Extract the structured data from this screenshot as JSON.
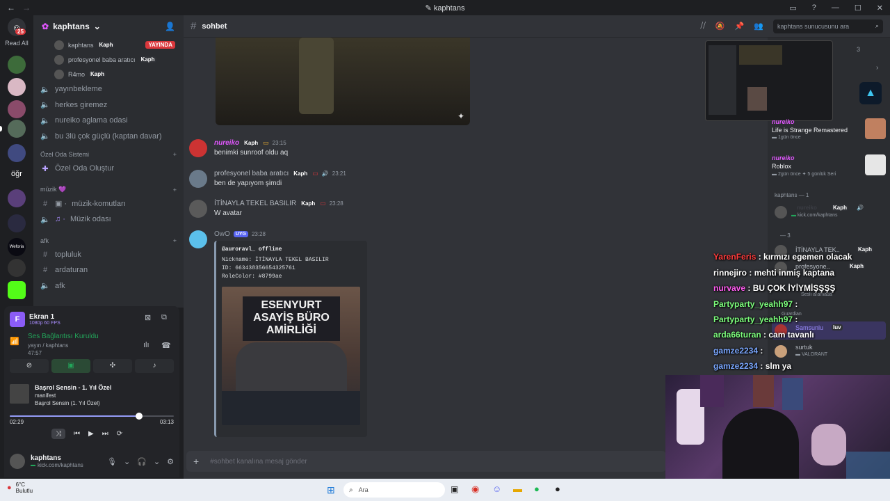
{
  "window": {
    "title": "kaphtans"
  },
  "rail": {
    "read_all": "Read All",
    "badge": "25",
    "ogr": "öğr",
    "weforia": "Weforia"
  },
  "server": {
    "name": "kaphtans",
    "voice_users": [
      {
        "name": "kaphtans",
        "tag": "Kaph",
        "live": "YAYINDA"
      },
      {
        "name": "profesyonel baba aratıcı",
        "tag": "Kaph"
      },
      {
        "name": "R4mo",
        "tag": "Kaph"
      }
    ],
    "channels_top": [
      "yayınbekleme",
      "herkes giremez",
      "nureiko aglama odasi",
      "bu 3lü çok güçlü (kaptan davar)"
    ],
    "cat_private": "Özel Oda Sistemi",
    "create_room": "Özel Oda Oluştur",
    "cat_music": "müzik 💜",
    "music_channels": [
      "müzik-komutları",
      "Müzik odası"
    ],
    "cat_afk": "afk",
    "afk_channels": [
      "topluluk",
      "ardaturan",
      "afk"
    ]
  },
  "panel": {
    "screen_title": "Ekran 1",
    "screen_sub": "1080p 60 FPS",
    "voice_status": "Ses Bağlantısı Kuruldu",
    "voice_channel": "yayın / kaphtans",
    "voice_time": "47:57",
    "song_title": "Başrol Sensin - 1. Yıl Özel",
    "song_artist": "manifest",
    "song_album": "Başrol Sensin (1. Yıl Özel)",
    "elapsed": "02:29",
    "total": "03:13",
    "progress": 0.79
  },
  "user": {
    "name": "kaphtans",
    "status": "kick.com/kaphtans"
  },
  "channel": {
    "name": "sohbet",
    "search_placeholder": "kaphtans sunucusunu ara",
    "input_placeholder": "#sohbet kanalına mesaj gönder"
  },
  "messages": [
    {
      "author": "nureiko",
      "tag": "Kaph",
      "time": "23:15",
      "text": "benimki sunroof oldu aq",
      "color": "#e056fd"
    },
    {
      "author": "profesyonel baba aratıcı",
      "tag": "Kaph",
      "time": "23:21",
      "text": "ben de yapıyom şimdi",
      "color": "#b5bac1"
    },
    {
      "author": "İTİNAYLA TEKEL BASILIR",
      "tag": "Kaph",
      "time": "23:28",
      "text": "W avatar",
      "color": "#b5bac1"
    }
  ],
  "bot": {
    "author": "OwO",
    "badge": "UYG",
    "time": "23:28",
    "embed_title": "@auroravl_ offline",
    "embed_lines": [
      "Nickname: İTİNAYLA TEKEL BASILIR",
      "ID: 663438356654325761",
      "RoleColor: #8799ae"
    ],
    "image_text_1": "ESENYURT",
    "image_text_2": "ASAYİŞ BÜRO",
    "image_text_3": "AMİRLİĞİ"
  },
  "activity": {
    "items": [
      {
        "user": "nureiko",
        "game": "Life is Strange Remastered",
        "meta": "1gün önce"
      },
      {
        "user": "nureiko",
        "game": "Roblox",
        "meta": "2gün önce",
        "streak": "5 günlük Seri"
      }
    ],
    "members_header": "kaphtans — 1",
    "member_status": "kick.com/kaphtans",
    "group_header": "— 3",
    "members": [
      {
        "name": "İTİNAYLA TEK..",
        "tag": "Kaph"
      },
      {
        "name": "profesyone..",
        "tag": "Kaph"
      },
      {
        "name": "Samsunlu",
        "tag": "luv"
      },
      {
        "name": "surtuk",
        "tag": "",
        "status": "VALORANT"
      }
    ],
    "voice_status": "Sesli aramada",
    "guardian": "Guardian",
    "screen_count": "3"
  },
  "overlay_chat": [
    {
      "user": "YarenFeris",
      "text": "kırmızı egemen olacak",
      "color": "#ff3b3b"
    },
    {
      "user": "rinnejiro",
      "text": "mehti inmiş kaptana",
      "color": "#ffffff"
    },
    {
      "user": "nurvave",
      "text": "BU ÇOK İYİYMİŞŞŞŞ",
      "color": "#ff5cf0"
    },
    {
      "user": "Partyparty_yeahh97",
      "text": "",
      "color": "#7dff7d"
    },
    {
      "user": "Partyparty_yeahh97",
      "text": "",
      "color": "#7dff7d"
    },
    {
      "user": "arda66turan",
      "text": "cam tavanlı",
      "color": "#7dff7d"
    },
    {
      "user": "gamze2234",
      "text": "",
      "color": "#7aa7ff"
    },
    {
      "user": "gamze2234",
      "text": "slm ya",
      "color": "#7aa7ff"
    }
  ],
  "taskbar": {
    "weather_temp": "6°C",
    "weather_desc": "Bulutlu",
    "search": "Ara"
  }
}
